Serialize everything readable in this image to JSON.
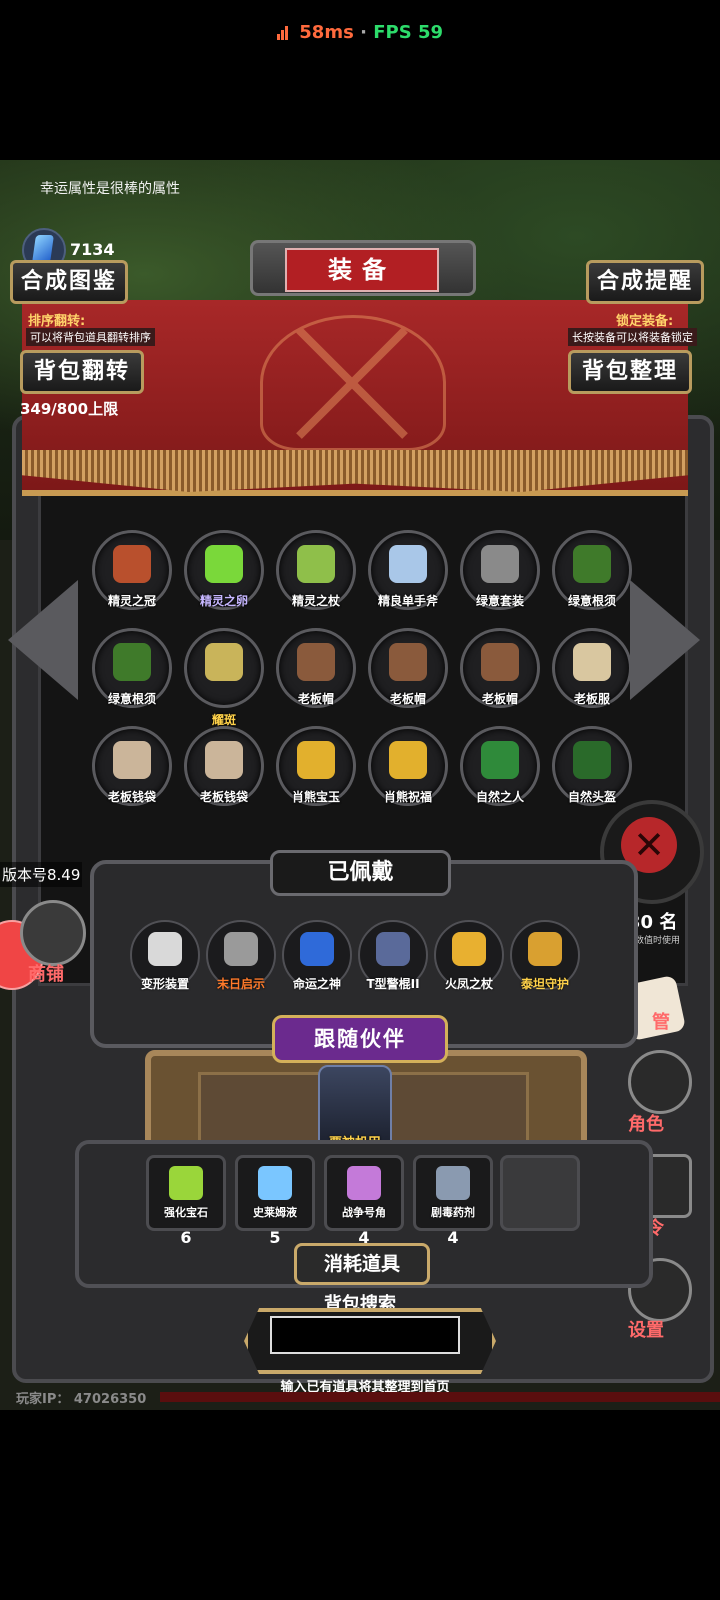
{
  "status": {
    "ping": "58ms",
    "separator": "·",
    "fps": "FPS 59"
  },
  "hud": {
    "hint": "幸运属性是很棒的属性",
    "gold": "7134"
  },
  "header": {
    "title": "装备",
    "left_top_button": "合成图鉴",
    "right_top_button": "合成提醒",
    "sort_label": "排序翻转:",
    "sort_desc": "可以将背包道具翻转排序",
    "lock_label": "锁定装备:",
    "lock_desc": "长按装备可以将装备锁定",
    "left_button": "背包翻转",
    "right_button": "背包整理",
    "capacity": "349/800上限"
  },
  "inventory": [
    {
      "name": "精灵之冠",
      "color": "#b9502d"
    },
    {
      "name": "精灵之卵",
      "color": "#7ad83a",
      "style": "purple"
    },
    {
      "name": "精灵之杖",
      "color": "#8fbf4a"
    },
    {
      "name": "精良单手斧",
      "color": "#a9c7e8"
    },
    {
      "name": "绿意套装",
      "color": "#8a8a8a"
    },
    {
      "name": "绿意根须",
      "color": "#3f7a2a"
    },
    {
      "name": "绿意根须",
      "color": "#3f7a2a"
    },
    {
      "name": "耀斑",
      "color": "#c9b45a",
      "style": "gold"
    },
    {
      "name": "老板帽",
      "color": "#8a5a3c"
    },
    {
      "name": "老板帽",
      "color": "#8a5a3c"
    },
    {
      "name": "老板帽",
      "color": "#8a5a3c"
    },
    {
      "name": "老板服",
      "color": "#d9c7a0"
    },
    {
      "name": "老板钱袋",
      "color": "#cbb59a"
    },
    {
      "name": "老板钱袋",
      "color": "#cbb59a"
    },
    {
      "name": "肖熊宝玉",
      "color": "#e2b02d"
    },
    {
      "name": "肖熊祝福",
      "color": "#e2b02d"
    },
    {
      "name": "自然之人",
      "color": "#2f8a3a"
    },
    {
      "name": "自然头盔",
      "color": "#2a6a2a"
    }
  ],
  "equipped": {
    "title": "已佩戴",
    "items": [
      {
        "name": "变形装置",
        "color": "#d9d9d9",
        "label_color": "#ffffff"
      },
      {
        "name": "末日启示",
        "color": "#9a9a9a",
        "label_color": "#ff7a2a"
      },
      {
        "name": "命运之神",
        "color": "#2f6ad9",
        "label_color": "#ffffff"
      },
      {
        "name": "T型警棍II",
        "color": "#5a6a9a",
        "label_color": "#ffffff"
      },
      {
        "name": "火凤之杖",
        "color": "#e8b030",
        "label_color": "#ffffff"
      },
      {
        "name": "泰坦守护",
        "color": "#d9a030",
        "label_color": "#ffd24a"
      }
    ]
  },
  "companion": {
    "title": "跟随伙伴",
    "name": "粟神机甲"
  },
  "consumables": {
    "title": "消耗道具",
    "items": [
      {
        "name": "强化宝石",
        "qty": "6",
        "color": "#9ad63a"
      },
      {
        "name": "史莱姆液",
        "qty": "5",
        "color": "#7ac6ff"
      },
      {
        "name": "战争号角",
        "qty": "4",
        "color": "#c47ad9"
      },
      {
        "name": "剧毒药剂",
        "qty": "4",
        "color": "#8a9ab0"
      }
    ]
  },
  "search": {
    "label": "背包搜索",
    "value": "",
    "hint": "输入已有道具将其整理到首页"
  },
  "side": {
    "version": "版本号8.49",
    "shop": "商铺",
    "count_partial": "30 名",
    "count_sub": "其数值时使用",
    "manage": "管",
    "role": "角色",
    "code": "口令",
    "settings": "设置"
  },
  "footer": {
    "player_ip": "玩家IP：  47026350"
  }
}
